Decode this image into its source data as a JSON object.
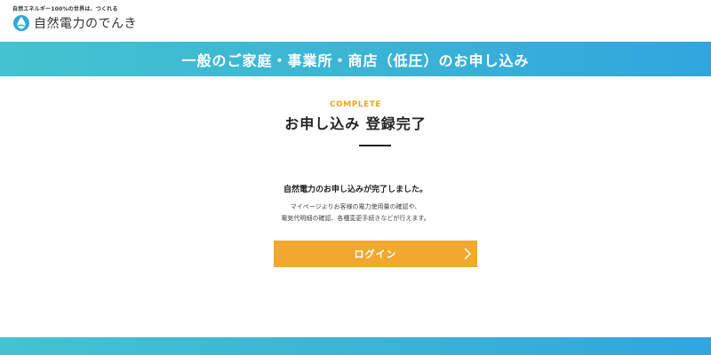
{
  "header": {
    "tagline": "自然エネルギー100%の世界は、つくれる",
    "logo_text": "自然電力のでんき",
    "logo_icon": "water-drop-icon"
  },
  "banner": {
    "title": "一般のご家庭・事業所・商店（低圧）のお申し込み"
  },
  "main": {
    "status_label": "COMPLETE",
    "heading": "お申し込み 登録完了",
    "message": "自然電力のお申し込みが完了しました。",
    "description_line1": "マイページよりお客様の電力使用量の確認や、",
    "description_line2": "電気代明細の確認、各種変更手続きなどが行えます。",
    "login_button": {
      "label": "ログイン",
      "icon": "chevron-right-icon"
    }
  },
  "colors": {
    "accent_orange": "#f1a82f",
    "band_start": "#43c3d0",
    "band_end": "#30a5de",
    "text_dark": "#222222"
  }
}
